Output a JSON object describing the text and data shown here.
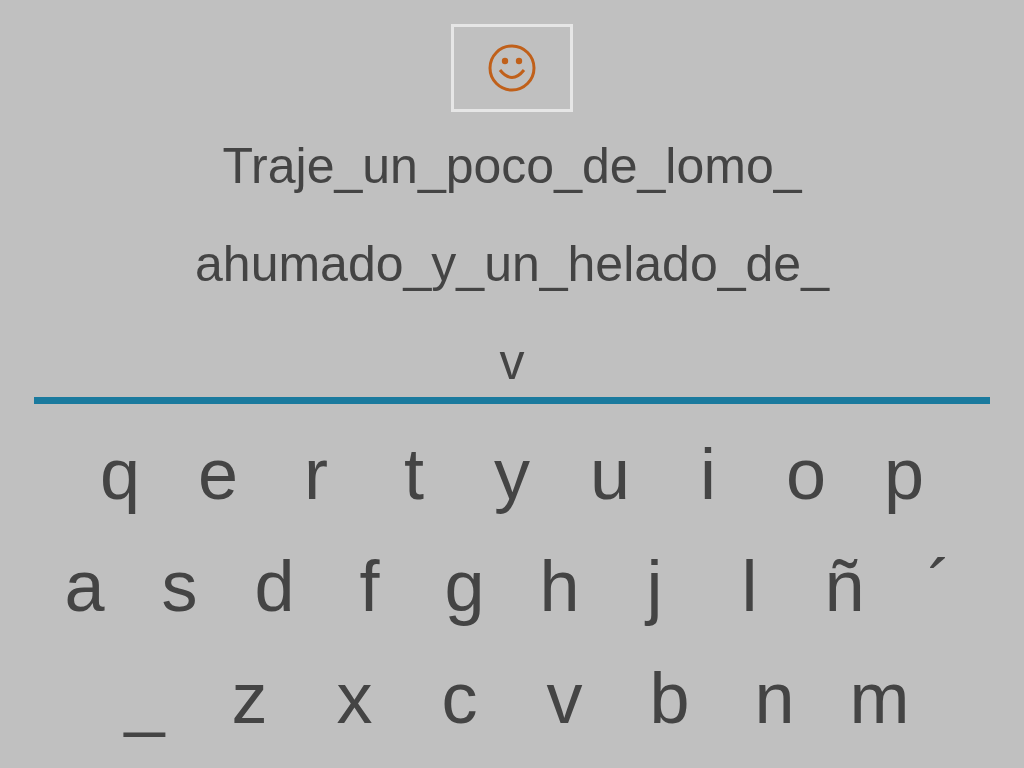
{
  "sentence_lines": [
    "Traje_un_poco_de_lomo_",
    "ahumado_y_un_helado_de_",
    "v"
  ],
  "keyboard_rows": [
    [
      "q",
      "e",
      "r",
      "t",
      "y",
      "u",
      "i",
      "o",
      "p"
    ],
    [
      "a",
      "s",
      "d",
      "f",
      "g",
      "h",
      "j",
      "l",
      "ñ",
      "´"
    ],
    [
      "_",
      "z",
      "x",
      "c",
      "v",
      "b",
      "n",
      "m"
    ]
  ]
}
